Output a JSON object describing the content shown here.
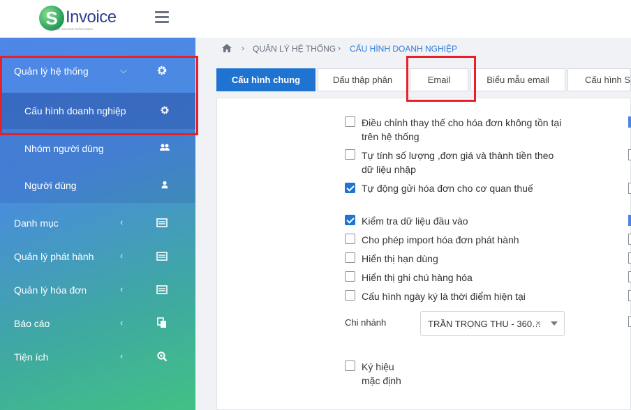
{
  "brand": {
    "logo_letter": "S",
    "logo_text": "Invoice",
    "tagline": "GIẢI PHÁP HÓA ĐƠN THÔNG MINH"
  },
  "sidebar": {
    "items": [
      {
        "label": "Quản lý hệ thống",
        "chevron": "⌵",
        "icon": "gear-icon"
      },
      {
        "label": "Cấu hình doanh nghiệp",
        "icon": "gear-icon"
      },
      {
        "label": "Nhóm người dùng",
        "icon": "users-icon"
      },
      {
        "label": "Người dùng",
        "icon": "user-icon"
      },
      {
        "label": "Danh mục",
        "chevron": "‹",
        "icon": "list-icon"
      },
      {
        "label": "Quản lý phát hành",
        "chevron": "‹",
        "icon": "list-icon"
      },
      {
        "label": "Quản lý hóa đơn",
        "chevron": "‹",
        "icon": "list-icon"
      },
      {
        "label": "Báo cáo",
        "chevron": "‹",
        "icon": "copy-icon"
      },
      {
        "label": "Tiện ích",
        "chevron": "‹",
        "icon": "zoom-icon"
      }
    ]
  },
  "breadcrumb": {
    "items": [
      "QUẢN LÝ HỆ THỐNG",
      "CẤU HÌNH DOANH NGHIỆP"
    ]
  },
  "tabs": [
    "Cấu hình chung",
    "Dấu thập phân",
    "Email",
    "Biểu mẫu email",
    "Cấu hình SMS"
  ],
  "settings": {
    "opt1": "Điều chỉnh thay thế cho hóa đơn không tồn tại",
    "opt1b": "trên hệ thống",
    "opt2": "Tự tính số lượng ,đơn giá và thành tiền theo",
    "opt2b": "dữ liệu nhập",
    "opt3": "Tự động gửi hóa đơn cho cơ quan thuế",
    "opt4": "Kiểm tra dữ liệu đầu vào",
    "opt5": "Cho phép import hóa đơn phát hành",
    "opt6": "Hiển thị hạn dùng",
    "opt7": "Hiển thị ghi chú hàng hóa",
    "opt8": "Cấu hình ngày ký là thời điểm hiện tại",
    "branch_label": "Chi nhánh",
    "branch_value": "TRẦN TRỌNG THU - 360…",
    "branch_clear": "×",
    "opt9": "Ký hiệu",
    "opt9b": "mặc định"
  },
  "colors": {
    "accent": "#1f73d1",
    "highlight": "#e8202a"
  }
}
